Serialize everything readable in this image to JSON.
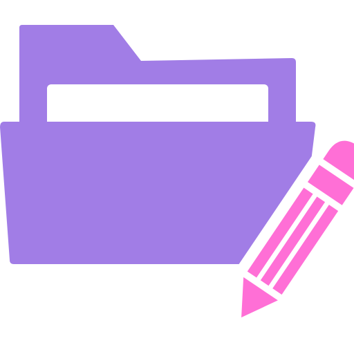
{
  "icon": {
    "name": "edit-folder-icon",
    "parts": [
      "folder-icon",
      "pencil-icon"
    ]
  },
  "colors": {
    "background": "#ffffff",
    "folder": "#A17DE6",
    "folder_paper": "#ffffff",
    "pencil": "#FF6FD6",
    "pencil_outline": "#ffffff"
  }
}
